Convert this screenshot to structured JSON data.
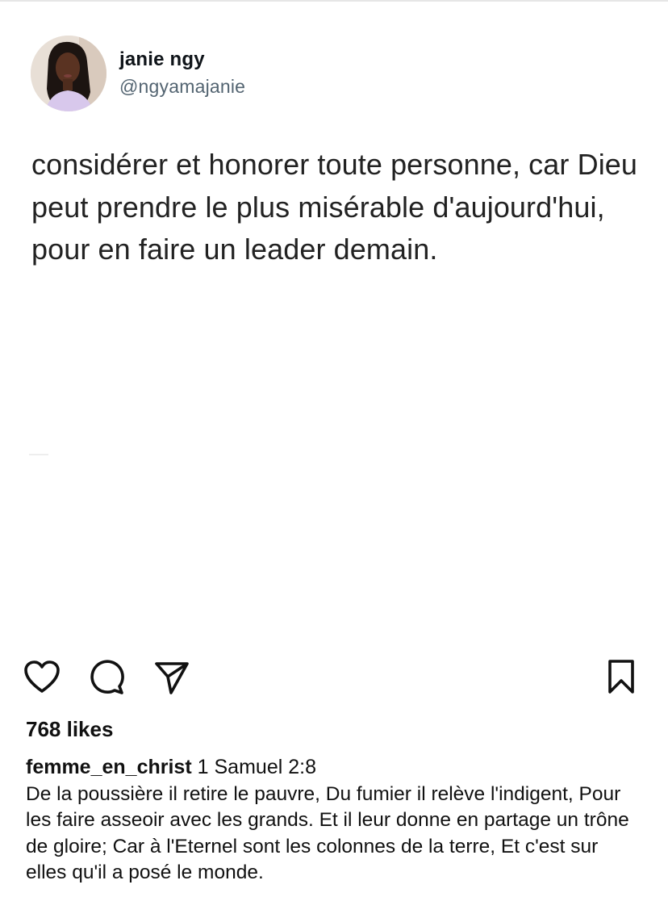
{
  "tweet": {
    "author_name": "janie ngy",
    "author_handle": "@ngyamajanie",
    "text": "considérer et honorer toute personne, car Dieu peut prendre le plus misérable d'aujourd'hui, pour en faire un leader demain."
  },
  "actions": {
    "like_icon": "heart-outline",
    "comment_icon": "speech-bubble-outline",
    "share_icon": "paper-plane-outline",
    "save_icon": "bookmark-outline"
  },
  "post": {
    "likes": "768 likes",
    "caption_user": "femme_en_christ",
    "caption_reference": "1 Samuel 2:8",
    "caption_text": "De la poussière il retire le pauvre, Du fumier il relève l'indigent, Pour les faire asseoir avec les grands. Et il leur donne en partage un trône de gloire; Car à l'Eternel sont les colonnes de la terre, Et c'est sur elles qu'il a posé le monde."
  }
}
